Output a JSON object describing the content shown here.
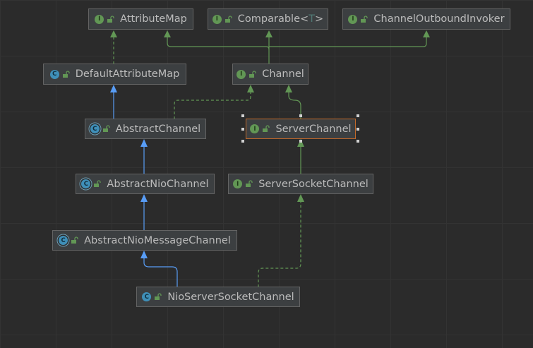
{
  "nodes": {
    "attribute_map": {
      "label": "AttributeMap",
      "kind": "interface",
      "icon_letter": "I"
    },
    "comparable": {
      "label": "Comparable",
      "type_param": "T",
      "kind": "interface",
      "icon_letter": "I"
    },
    "channel_outbound_invoker": {
      "label": "ChannelOutboundInvoker",
      "kind": "interface",
      "icon_letter": "I"
    },
    "default_attribute_map": {
      "label": "DefaultAttributeMap",
      "kind": "class",
      "icon_letter": "C"
    },
    "channel": {
      "label": "Channel",
      "kind": "interface",
      "icon_letter": "I"
    },
    "abstract_channel": {
      "label": "AbstractChannel",
      "kind": "abstract",
      "icon_letter": "C"
    },
    "server_channel": {
      "label": "ServerChannel",
      "kind": "interface",
      "icon_letter": "I"
    },
    "abstract_nio_channel": {
      "label": "AbstractNioChannel",
      "kind": "abstract",
      "icon_letter": "C"
    },
    "server_socket_channel": {
      "label": "ServerSocketChannel",
      "kind": "interface",
      "icon_letter": "I"
    },
    "abstract_nio_message_channel": {
      "label": "AbstractNioMessageChannel",
      "kind": "abstract",
      "icon_letter": "C"
    },
    "nio_server_socket_channel": {
      "label": "NioServerSocketChannel",
      "kind": "class",
      "icon_letter": "C"
    }
  },
  "selected_node": "server_channel",
  "colors": {
    "background": "#2b2b2b",
    "node_fill": "#3c3f41",
    "node_border": "#646464",
    "selected_border": "#c0682a",
    "text": "#bbbbbb",
    "extends_edge": "#589df6",
    "implements_edge": "#629755",
    "interface_icon": "#629755",
    "class_icon": "#3f8fb8"
  },
  "edges": [
    {
      "from": "default_attribute_map",
      "to": "attribute_map",
      "relation": "implements"
    },
    {
      "from": "channel",
      "to": "attribute_map",
      "relation": "extends-interface"
    },
    {
      "from": "channel",
      "to": "comparable",
      "relation": "extends-interface"
    },
    {
      "from": "channel",
      "to": "channel_outbound_invoker",
      "relation": "extends-interface"
    },
    {
      "from": "abstract_channel",
      "to": "default_attribute_map",
      "relation": "extends"
    },
    {
      "from": "abstract_channel",
      "to": "channel",
      "relation": "implements"
    },
    {
      "from": "server_channel",
      "to": "channel",
      "relation": "extends-interface"
    },
    {
      "from": "abstract_nio_channel",
      "to": "abstract_channel",
      "relation": "extends"
    },
    {
      "from": "server_socket_channel",
      "to": "server_channel",
      "relation": "extends-interface"
    },
    {
      "from": "abstract_nio_message_channel",
      "to": "abstract_nio_channel",
      "relation": "extends"
    },
    {
      "from": "nio_server_socket_channel",
      "to": "abstract_nio_message_channel",
      "relation": "extends"
    },
    {
      "from": "nio_server_socket_channel",
      "to": "server_socket_channel",
      "relation": "implements"
    }
  ]
}
